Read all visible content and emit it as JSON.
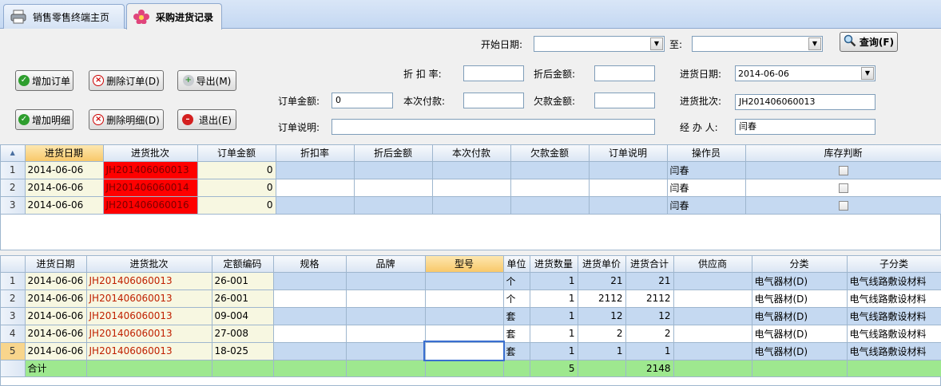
{
  "tabs": [
    {
      "label": "销售零售终端主页"
    },
    {
      "label": "采购进货记录"
    }
  ],
  "search": {
    "start_date_label": "开始日期:",
    "start_date": "",
    "to_label": "至:",
    "end_date": "",
    "query_button": "查询(F)"
  },
  "toolbar": {
    "add_order": "增加订单",
    "delete_order": "删除订单(D)",
    "export": "导出(M)",
    "add_detail": "增加明细",
    "delete_detail": "删除明细(D)",
    "exit": "退出(E)"
  },
  "form": {
    "discount_rate_label": "折 扣 率:",
    "discount_rate": "",
    "discounted_amount_label": "折后金额:",
    "discounted_amount": "",
    "purchase_date_label": "进货日期:",
    "purchase_date": "2014-06-06",
    "order_amount_label": "订单金额:",
    "order_amount": "0",
    "current_payment_label": "本次付款:",
    "current_payment": "",
    "arrears_label": "欠款金额:",
    "arrears": "",
    "purchase_batch_label": "进货批次:",
    "purchase_batch": "JH201406060013",
    "order_note_label": "订单说明:",
    "order_note": "",
    "handler_label": "经 办 人:",
    "handler": "闫春"
  },
  "orders_grid": {
    "sort_icon": "sort-arrow-icon",
    "columns": [
      "进货日期",
      "进货批次",
      "订单金额",
      "折扣率",
      "折后金额",
      "本次付款",
      "欠款金额",
      "订单说明",
      "操作员",
      "库存判断"
    ],
    "rows": [
      {
        "n": "1",
        "date": "2014-06-06",
        "batch": "JH201406060013",
        "amount": "0",
        "rate": "",
        "discounted": "",
        "payment": "",
        "arrears": "",
        "note": "",
        "operator": "闫春",
        "stock": false
      },
      {
        "n": "2",
        "date": "2014-06-06",
        "batch": "JH201406060014",
        "amount": "0",
        "rate": "",
        "discounted": "",
        "payment": "",
        "arrears": "",
        "note": "",
        "operator": "闫春",
        "stock": false
      },
      {
        "n": "3",
        "date": "2014-06-06",
        "batch": "JH201406060016",
        "amount": "0",
        "rate": "",
        "discounted": "",
        "payment": "",
        "arrears": "",
        "note": "",
        "operator": "闫春",
        "stock": false
      }
    ]
  },
  "details_grid": {
    "columns": [
      "进货日期",
      "进货批次",
      "定额编码",
      "规格",
      "品牌",
      "型号",
      "单位",
      "进货数量",
      "进货单价",
      "进货合计",
      "供应商",
      "分类",
      "子分类"
    ],
    "rows": [
      {
        "n": "1",
        "date": "2014-06-06",
        "batch": "JH201406060013",
        "code": "26-001",
        "spec": "",
        "brand": "",
        "model": "",
        "unit": "个",
        "qty": "1",
        "price": "21",
        "total": "21",
        "supplier": "",
        "category": "电气器材(D)",
        "subcategory": "电气线路敷设材料"
      },
      {
        "n": "2",
        "date": "2014-06-06",
        "batch": "JH201406060013",
        "code": "26-001",
        "spec": "",
        "brand": "",
        "model": "",
        "unit": "个",
        "qty": "1",
        "price": "2112",
        "total": "2112",
        "supplier": "",
        "category": "电气器材(D)",
        "subcategory": "电气线路敷设材料"
      },
      {
        "n": "3",
        "date": "2014-06-06",
        "batch": "JH201406060013",
        "code": "09-004",
        "spec": "",
        "brand": "",
        "model": "",
        "unit": "套",
        "qty": "1",
        "price": "12",
        "total": "12",
        "supplier": "",
        "category": "电气器材(D)",
        "subcategory": "电气线路敷设材料"
      },
      {
        "n": "4",
        "date": "2014-06-06",
        "batch": "JH201406060013",
        "code": "27-008",
        "spec": "",
        "brand": "",
        "model": "",
        "unit": "套",
        "qty": "1",
        "price": "2",
        "total": "2",
        "supplier": "",
        "category": "电气器材(D)",
        "subcategory": "电气线路敷设材料"
      },
      {
        "n": "5",
        "date": "2014-06-06",
        "batch": "JH201406060013",
        "code": "18-025",
        "spec": "",
        "brand": "",
        "model": "",
        "unit": "套",
        "qty": "1",
        "price": "1",
        "total": "1",
        "supplier": "",
        "category": "电气器材(D)",
        "subcategory": "电气线路敷设材料"
      }
    ],
    "total_row": {
      "label": "合计",
      "qty": "5",
      "total": "2148"
    }
  }
}
